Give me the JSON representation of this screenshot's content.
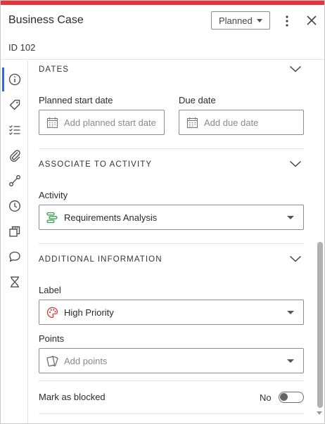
{
  "header": {
    "title": "Business Case",
    "item_id": "ID 102",
    "status_label": "Planned"
  },
  "sidebar": {
    "items": [
      {
        "icon": "info-icon",
        "active": true
      },
      {
        "icon": "tag-icon"
      },
      {
        "icon": "checklist-icon"
      },
      {
        "icon": "attachment-icon"
      },
      {
        "icon": "dependency-icon"
      },
      {
        "icon": "clock-icon"
      },
      {
        "icon": "copy-icon"
      },
      {
        "icon": "comment-icon"
      },
      {
        "icon": "hourglass-icon"
      }
    ]
  },
  "sections": {
    "dates": {
      "title": "DATES",
      "start_label": "Planned start date",
      "start_placeholder": "Add planned start date",
      "due_label": "Due date",
      "due_placeholder": "Add due date"
    },
    "activity": {
      "title": "ASSOCIATE TO ACTIVITY",
      "activity_label": "Activity",
      "activity_value": "Requirements Analysis"
    },
    "additional": {
      "title": "ADDITIONAL INFORMATION",
      "label_label": "Label",
      "label_value": "High Priority",
      "points_label": "Points",
      "points_placeholder": "Add points",
      "blocked_label": "Mark as blocked",
      "blocked_value": "No"
    }
  },
  "colors": {
    "accent_bar": "#e8323a",
    "active_tab": "#2d6ad6",
    "activity_icon": "#2e9c4f",
    "label_icon": "#d23a3a"
  }
}
